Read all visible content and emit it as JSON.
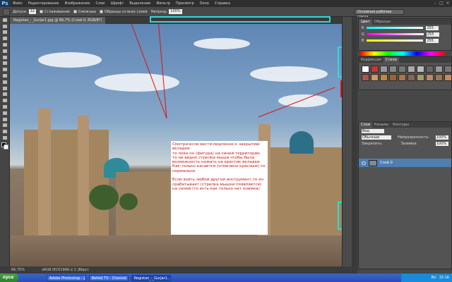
{
  "app": {
    "logo": "Ps"
  },
  "menu": [
    "Файл",
    "Редактирование",
    "Изображение",
    "Слои",
    "Шрифт",
    "Выделение",
    "Фильтр",
    "Просмотр",
    "Окно",
    "Справка"
  ],
  "options": {
    "feather_label": "Допуск:",
    "feather_value": "32",
    "antialias_label": "Сглаживание",
    "contiguous_label": "Смежные",
    "sample_all_label": "Образцы со всех слоев",
    "opacity_label": "Непрозр.",
    "opacity_value": "100%",
    "workspace": "Основная рабочая среда"
  },
  "document": {
    "tab_title": "Registan_-_Gurjar1.jpg @ 66,7% (Слой 0, RGB/8*)",
    "note_text": "Смотри:если вести медленно к закрытию вкладки\nто пока он (фигура) на синей территории\nто не видно стрелки мыши чтобы была возможность нажать на крестик вкладки\nКак только касается (отмечено красным),то нормально\n\nЕсли взять любой другой инструмент,то он срабатывает (стрелка мышки появляется) на синей (то есть как только нет онимка)"
  },
  "status": {
    "zoom": "66,75%",
    "info": "sRGB IEC61966-2.1 (8bpc)"
  },
  "panels": {
    "color_tabs": [
      "Цвет",
      "Образцы"
    ],
    "color_rows": [
      {
        "label": "R",
        "value": "255"
      },
      {
        "label": "G",
        "value": "255"
      },
      {
        "label": "B",
        "value": "255"
      }
    ],
    "styles_tabs": [
      "Коррекция",
      "Стили"
    ],
    "layers_tabs": [
      "Слои",
      "Каналы",
      "Контуры"
    ],
    "kind_label": "Вид",
    "blend_mode": "Обычные",
    "opacity_label": "Непрозрачность:",
    "opacity_value": "100%",
    "lock_label": "Закрепить:",
    "fill_label": "Заливка:",
    "fill_value": "100%",
    "layer_name": "Слой 0"
  },
  "taskbar": {
    "start": "пуск",
    "tasks": [
      "Adobe Photoshop - [...",
      "Befold TV - Channel ...",
      "Registan_-_Gurjar1..."
    ],
    "lang": "RU",
    "time": "15:16"
  }
}
